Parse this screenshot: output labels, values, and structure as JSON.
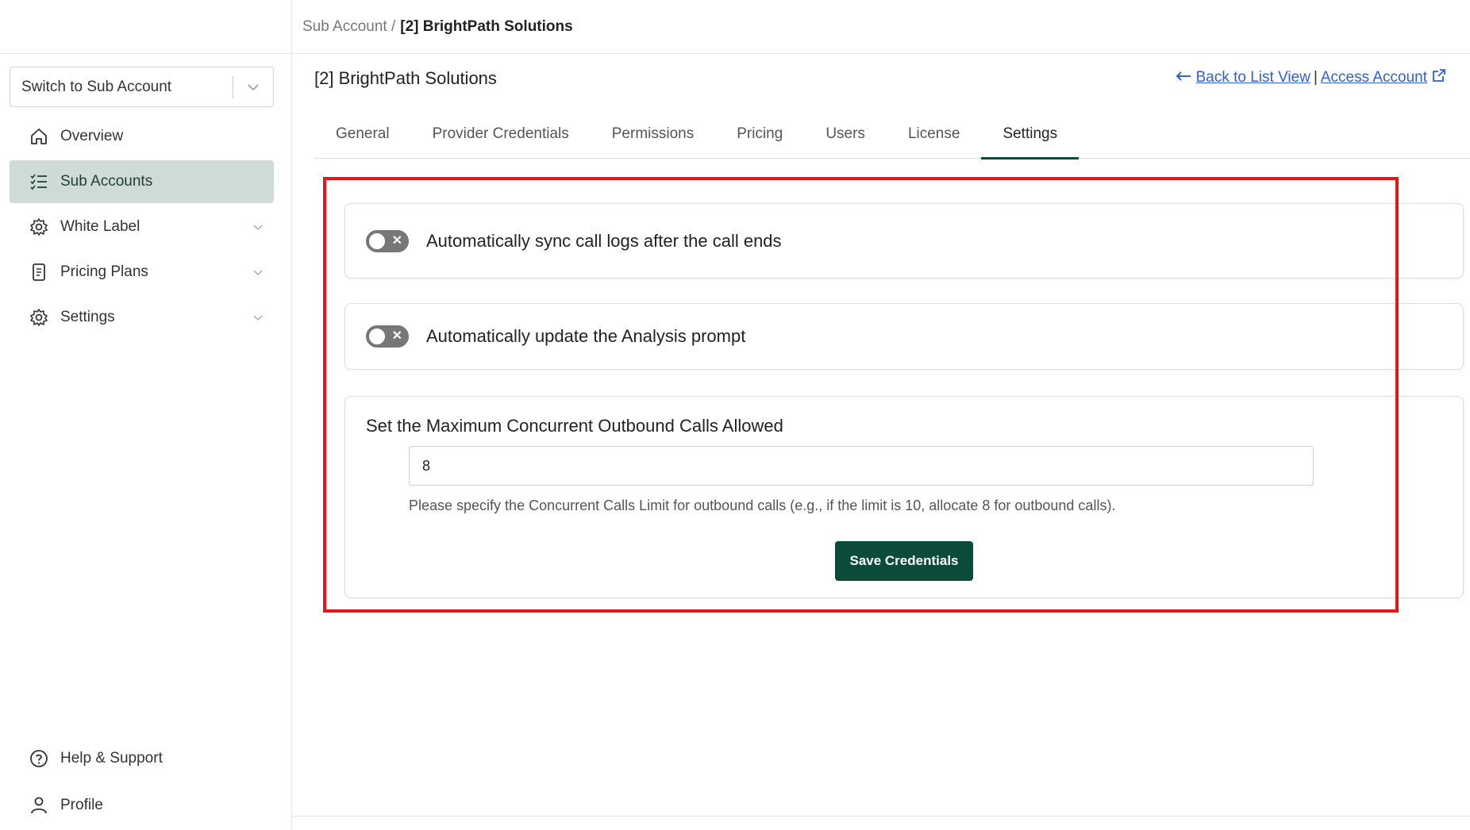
{
  "sidebar": {
    "switcher_label": "Switch to Sub Account",
    "items": [
      {
        "label": "Overview",
        "icon": "home-icon"
      },
      {
        "label": "Sub Accounts",
        "icon": "list-check-icon",
        "active": true
      },
      {
        "label": "White Label",
        "icon": "gear-icon",
        "expandable": true
      },
      {
        "label": "Pricing Plans",
        "icon": "receipt-icon",
        "expandable": true
      },
      {
        "label": "Settings",
        "icon": "gear-icon",
        "expandable": true
      }
    ],
    "bottom_items": [
      {
        "label": "Help & Support",
        "icon": "help-circle-icon"
      },
      {
        "label": "Profile",
        "icon": "user-icon"
      }
    ]
  },
  "breadcrumb": {
    "parent": "Sub Account /",
    "current": "[2] BrightPath Solutions"
  },
  "page": {
    "title": "[2] BrightPath Solutions",
    "back_link": "Back to List View",
    "separator": "|",
    "access_link": "Access Account"
  },
  "tabs": [
    {
      "label": "General"
    },
    {
      "label": "Provider Credentials"
    },
    {
      "label": "Permissions"
    },
    {
      "label": "Pricing"
    },
    {
      "label": "Users"
    },
    {
      "label": "License"
    },
    {
      "label": "Settings",
      "active": true
    }
  ],
  "settings": {
    "toggle_sync_label": "Automatically sync call logs after the call ends",
    "toggle_sync_on": false,
    "toggle_prompt_label": "Automatically update the Analysis prompt",
    "toggle_prompt_on": false,
    "limit_title": "Set the Maximum Concurrent Outbound Calls Allowed",
    "limit_value": "8",
    "limit_hint": "Please specify the Concurrent Calls Limit for outbound calls (e.g., if the limit is 10, allocate 8 for outbound calls).",
    "save_label": "Save Credentials"
  },
  "colors": {
    "primary": "#0c4a3a",
    "active_nav_bg": "#cfdbd6",
    "link": "#2f5fd0",
    "highlight_border": "#e8141c"
  }
}
